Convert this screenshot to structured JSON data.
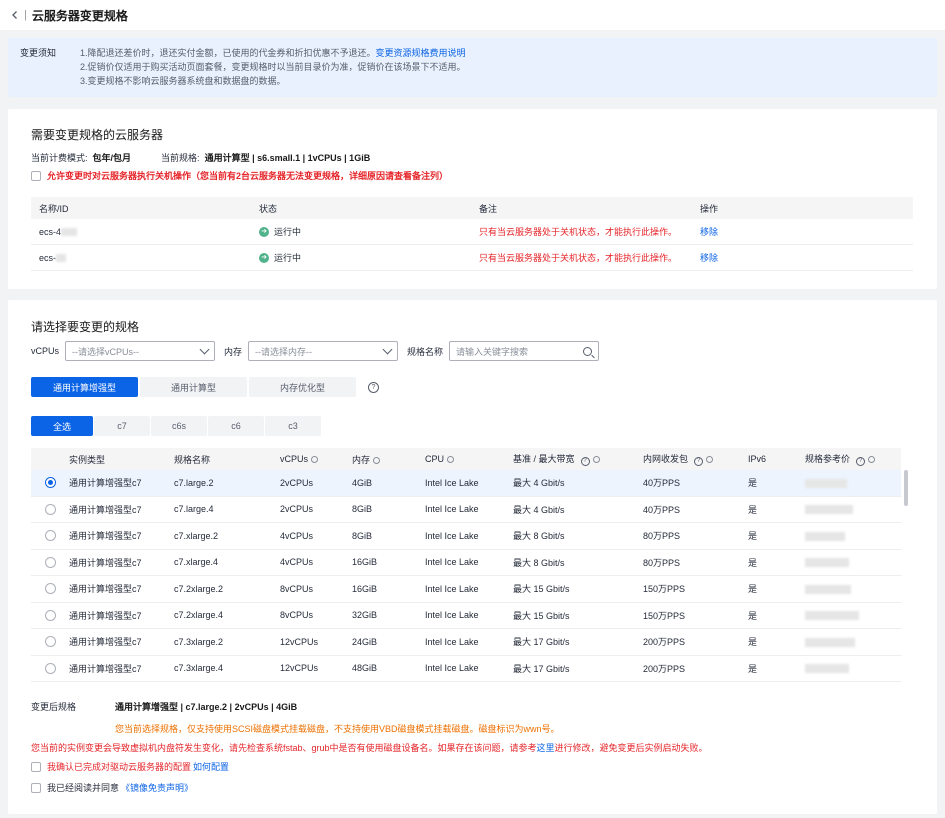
{
  "header": {
    "title": "云服务器变更规格"
  },
  "notice": {
    "label": "变更须知",
    "line1": "1.降配退还差价时，退还实付金额，已使用的代金券和折扣优惠不予退还。",
    "line1_link": "变更资源规格费用说明",
    "line2": "2.促销价仅适用于购买活动页面套餐，变更规格时以当前目录价为准，促销价在该场景下不适用。",
    "line3": "3.变更规格不影响云服务器系统盘和数据盘的数据。"
  },
  "servers": {
    "title": "需要变更规格的云服务器",
    "billing_label": "当前计费模式:",
    "billing_value": "包年/包月",
    "spec_label": "当前规格:",
    "spec_value": "通用计算型 | s6.small.1 | 1vCPUs | 1GiB",
    "shutdown_option": "允许变更时对云服务器执行关机操作（您当前有2台云服务器无法变更规格，详细原因请查看备注列）",
    "columns": [
      "名称/ID",
      "状态",
      "备注",
      "操作"
    ],
    "rows": [
      {
        "name": "ecs-4",
        "status": "运行中",
        "remark": "只有当云服务器处于关机状态，才能执行此操作。",
        "action": "移除"
      },
      {
        "name": "ecs-",
        "status": "运行中",
        "remark": "只有当云服务器处于关机状态，才能执行此操作。",
        "action": "移除"
      }
    ]
  },
  "spec_select": {
    "title": "请选择要变更的规格",
    "vcpu_label": "vCPUs",
    "vcpu_placeholder": "--请选择vCPUs--",
    "mem_label": "内存",
    "mem_placeholder": "--请选择内存--",
    "name_label": "规格名称",
    "name_placeholder": "请输入关键字搜索",
    "type_tabs": [
      "通用计算增强型",
      "通用计算型",
      "内存优化型"
    ],
    "family_tabs": [
      "全选",
      "c7",
      "c6s",
      "c6",
      "c3"
    ],
    "columns": [
      "实例类型",
      "规格名称",
      "vCPUs",
      "内存",
      "CPU",
      "基准 / 最大带宽",
      "内网收发包",
      "IPv6",
      "规格参考价"
    ],
    "rows": [
      {
        "type": "通用计算增强型c7",
        "name": "c7.large.2",
        "vcpus": "2vCPUs",
        "mem": "4GiB",
        "cpu": "Intel Ice Lake",
        "bw": "最大 4 Gbit/s",
        "pps": "40万PPS",
        "ipv6": "是",
        "selected": true
      },
      {
        "type": "通用计算增强型c7",
        "name": "c7.large.4",
        "vcpus": "2vCPUs",
        "mem": "8GiB",
        "cpu": "Intel Ice Lake",
        "bw": "最大 4 Gbit/s",
        "pps": "40万PPS",
        "ipv6": "是",
        "selected": false
      },
      {
        "type": "通用计算增强型c7",
        "name": "c7.xlarge.2",
        "vcpus": "4vCPUs",
        "mem": "8GiB",
        "cpu": "Intel Ice Lake",
        "bw": "最大 8 Gbit/s",
        "pps": "80万PPS",
        "ipv6": "是",
        "selected": false
      },
      {
        "type": "通用计算增强型c7",
        "name": "c7.xlarge.4",
        "vcpus": "4vCPUs",
        "mem": "16GiB",
        "cpu": "Intel Ice Lake",
        "bw": "最大 8 Gbit/s",
        "pps": "80万PPS",
        "ipv6": "是",
        "selected": false
      },
      {
        "type": "通用计算增强型c7",
        "name": "c7.2xlarge.2",
        "vcpus": "8vCPUs",
        "mem": "16GiB",
        "cpu": "Intel Ice Lake",
        "bw": "最大 15 Gbit/s",
        "pps": "150万PPS",
        "ipv6": "是",
        "selected": false
      },
      {
        "type": "通用计算增强型c7",
        "name": "c7.2xlarge.4",
        "vcpus": "8vCPUs",
        "mem": "32GiB",
        "cpu": "Intel Ice Lake",
        "bw": "最大 15 Gbit/s",
        "pps": "150万PPS",
        "ipv6": "是",
        "selected": false
      },
      {
        "type": "通用计算增强型c7",
        "name": "c7.3xlarge.2",
        "vcpus": "12vCPUs",
        "mem": "24GiB",
        "cpu": "Intel Ice Lake",
        "bw": "最大 17 Gbit/s",
        "pps": "200万PPS",
        "ipv6": "是",
        "selected": false
      },
      {
        "type": "通用计算增强型c7",
        "name": "c7.3xlarge.4",
        "vcpus": "12vCPUs",
        "mem": "48GiB",
        "cpu": "Intel Ice Lake",
        "bw": "最大 17 Gbit/s",
        "pps": "200万PPS",
        "ipv6": "是",
        "selected": false
      }
    ],
    "after_label": "变更后规格",
    "after_value": "通用计算增强型 | c7.large.2 | 2vCPUs | 4GiB",
    "disk_note": "您当前选择规格，仅支持使用SCSI磁盘模式挂载磁盘，不支持使用VBD磁盘模式挂载磁盘。磁盘标识为wwn号。",
    "warn_note_a": "您当前的实例变更会导致虚拟机内盘符发生变化，请先检查系统fstab、grub中是否有使用磁盘设备名。如果存在该问题，请参考",
    "warn_note_link": "这里",
    "warn_note_b": "进行修改，避免变更后实例启动失败。",
    "confirm1": "我确认已完成对驱动云服务器的配置",
    "confirm1_link": "如何配置",
    "confirm2": "我已经阅读并同意",
    "confirm2_link": "《镜像免责声明》"
  },
  "colors": {
    "accent": "#0b63e5",
    "danger": "#e5252a",
    "warning": "#ed7000",
    "success": "#50b38c"
  }
}
